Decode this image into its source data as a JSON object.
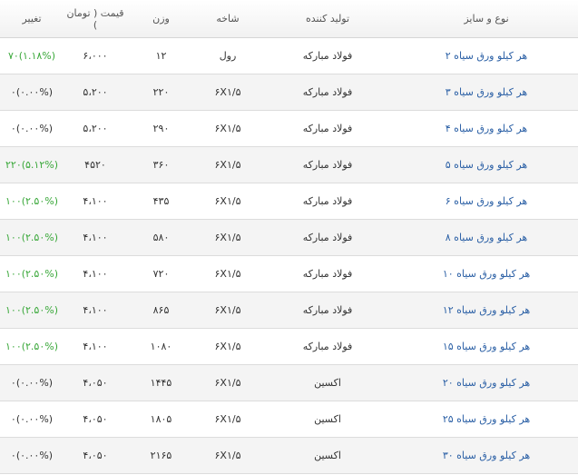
{
  "table": {
    "headers": {
      "name": "نوع و سایز",
      "producer": "تولید کننده",
      "branch": "شاخه",
      "weight": "وزن",
      "price": "قیمت ( تومان )",
      "change": "تغییر"
    },
    "rows": [
      {
        "name": "هر کیلو ورق سیاه ۲",
        "producer": "فولاد مبارکه",
        "branch": "رول",
        "weight": "۱۲",
        "price": "۶،۰۰۰",
        "change": "۷۰(۱.۱۸%)",
        "trend": "pos"
      },
      {
        "name": "هر کیلو ورق سیاه ۳",
        "producer": "فولاد مبارکه",
        "branch": "۶X۱/۵",
        "weight": "۲۲۰",
        "price": "۵،۲۰۰",
        "change": "۰(۰.۰۰%)",
        "trend": "zero"
      },
      {
        "name": "هر کیلو ورق سیاه ۴",
        "producer": "فولاد مبارکه",
        "branch": "۶X۱/۵",
        "weight": "۲۹۰",
        "price": "۵،۲۰۰",
        "change": "۰(۰.۰۰%)",
        "trend": "zero"
      },
      {
        "name": "هر کیلو ورق سیاه ۵",
        "producer": "فولاد مبارکه",
        "branch": "۶X۱/۵",
        "weight": "۳۶۰",
        "price": "۴۵۲۰",
        "change": "۲۲۰(۵.۱۲%)",
        "trend": "pos"
      },
      {
        "name": "هر کیلو ورق سیاه ۶",
        "producer": "فولاد مبارکه",
        "branch": "۶X۱/۵",
        "weight": "۴۳۵",
        "price": "۴،۱۰۰",
        "change": "۱۰۰(۲.۵۰%)",
        "trend": "pos"
      },
      {
        "name": "هر کیلو ورق سیاه ۸",
        "producer": "فولاد مبارکه",
        "branch": "۶X۱/۵",
        "weight": "۵۸۰",
        "price": "۴،۱۰۰",
        "change": "۱۰۰(۲.۵۰%)",
        "trend": "pos"
      },
      {
        "name": "هر کیلو ورق سیاه ۱۰",
        "producer": "فولاد مبارکه",
        "branch": "۶X۱/۵",
        "weight": "۷۲۰",
        "price": "۴،۱۰۰",
        "change": "۱۰۰(۲.۵۰%)",
        "trend": "pos"
      },
      {
        "name": "هر کیلو ورق سیاه ۱۲",
        "producer": "فولاد مبارکه",
        "branch": "۶X۱/۵",
        "weight": "۸۶۵",
        "price": "۴،۱۰۰",
        "change": "۱۰۰(۲.۵۰%)",
        "trend": "pos"
      },
      {
        "name": "هر کیلو ورق سیاه ۱۵",
        "producer": "فولاد مبارکه",
        "branch": "۶X۱/۵",
        "weight": "۱۰۸۰",
        "price": "۴،۱۰۰",
        "change": "۱۰۰(۲.۵۰%)",
        "trend": "pos"
      },
      {
        "name": "هر کیلو ورق سیاه ۲۰",
        "producer": "اکسین",
        "branch": "۶X۱/۵",
        "weight": "۱۴۴۵",
        "price": "۴،۰۵۰",
        "change": "۰(۰.۰۰%)",
        "trend": "zero"
      },
      {
        "name": "هر کیلو ورق سیاه ۲۵",
        "producer": "اکسین",
        "branch": "۶X۱/۵",
        "weight": "۱۸۰۵",
        "price": "۴،۰۵۰",
        "change": "۰(۰.۰۰%)",
        "trend": "zero"
      },
      {
        "name": "هر کیلو ورق سیاه ۳۰",
        "producer": "اکسین",
        "branch": "۶X۱/۵",
        "weight": "۲۱۶۵",
        "price": "۴،۰۵۰",
        "change": "۰(۰.۰۰%)",
        "trend": "zero"
      }
    ]
  },
  "colors": {
    "link": "#2a5fa5",
    "positive": "#3aa83a",
    "neutral": "#333333",
    "header_text": "#555555"
  }
}
